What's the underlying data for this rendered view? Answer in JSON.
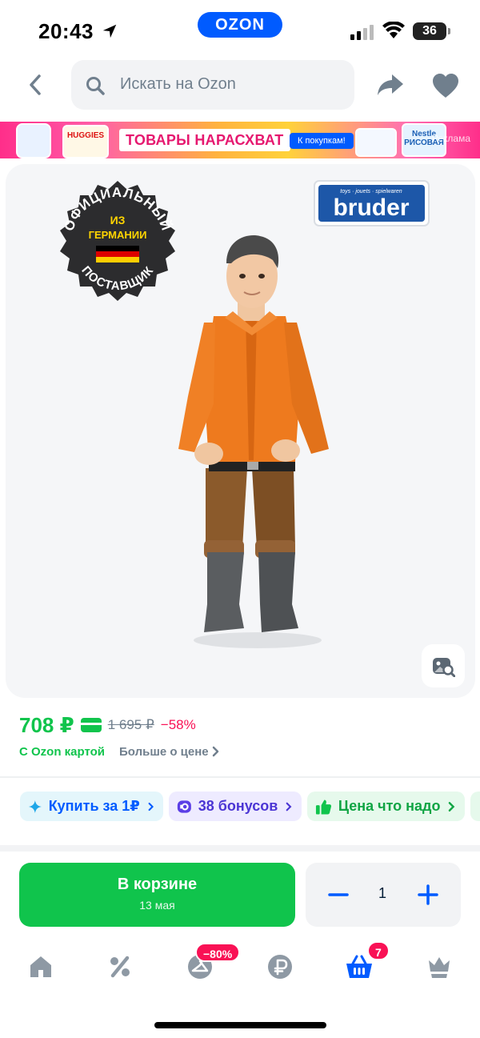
{
  "status_bar": {
    "time": "20:43",
    "brand": "OZON",
    "battery": "36"
  },
  "search": {
    "placeholder": "Искать на Ozon"
  },
  "ad": {
    "title": "ТОВАРЫ НАРАСХВАТ",
    "cta": "К покупкам!",
    "label": "Реклама",
    "product_1_text": "HUGGIES",
    "product_2_text": "Nestle РИСОВАЯ"
  },
  "image": {
    "badge_top": "ОФИЦИАЛЬНЫЙ",
    "badge_mid_1": "ИЗ",
    "badge_mid_2": "ГЕРМАНИИ",
    "badge_bottom": "ПОСТАВЩИК",
    "brand_logo": "bruder",
    "brand_tagline": "toys · jouets · spielwaren"
  },
  "price": {
    "current": "708 ₽",
    "old": "1 695 ₽",
    "discount": "−58%",
    "card_label": "С Ozon картой",
    "more_label": "Больше о цене"
  },
  "chips": [
    {
      "label": "Купить за 1₽"
    },
    {
      "label": "38 бонусов"
    },
    {
      "label": "Цена что надо"
    }
  ],
  "cart": {
    "label": "В корзине",
    "date": "13 мая",
    "quantity": "1"
  },
  "nav": {
    "promo_badge": "−80%",
    "cart_badge": "7"
  },
  "colors": {
    "accent": "#005bff",
    "green": "#10c44c",
    "pink": "#f91155"
  }
}
